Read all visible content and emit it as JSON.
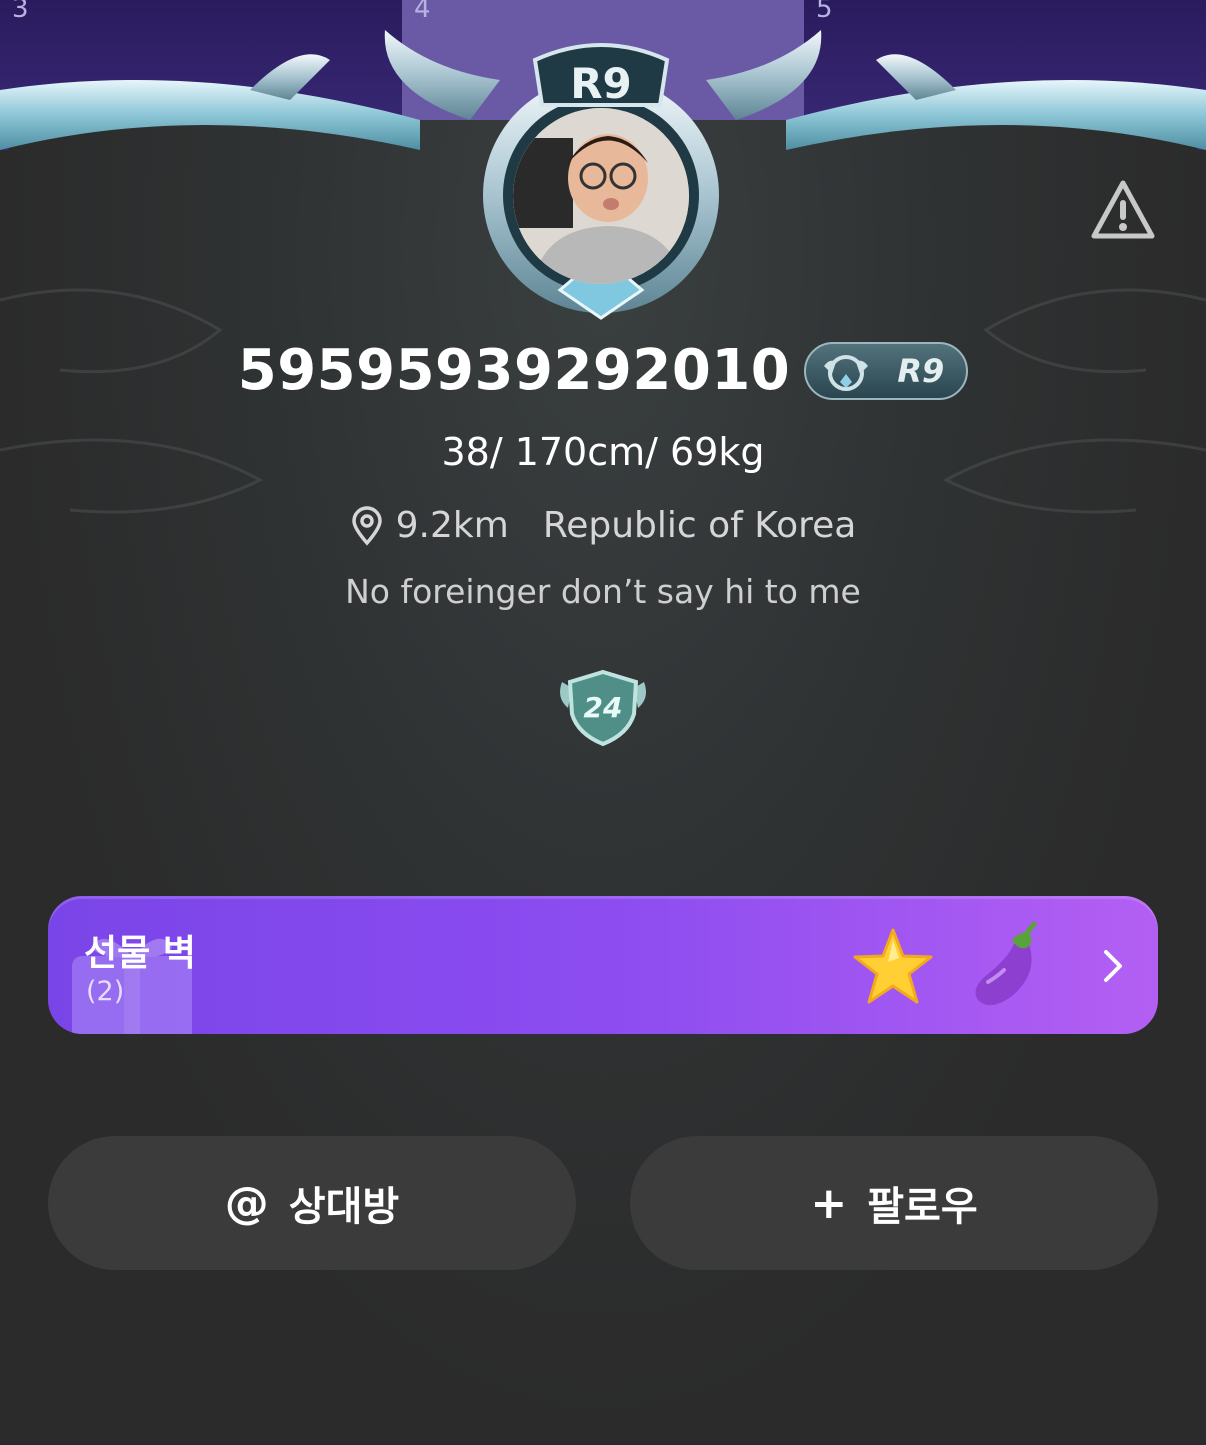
{
  "tabs": {
    "left": "3",
    "center": "4",
    "right": "5"
  },
  "frame": {
    "rank_label": "R9"
  },
  "profile": {
    "username": "59595939292010",
    "rank_badge": "R9",
    "stats": "38/ 170cm/ 69kg",
    "distance": "9.2km",
    "country": "Republic of Korea",
    "bio": "No foreinger don’t say hi to me",
    "level": "24"
  },
  "gift_wall": {
    "title": "선물 벽",
    "count": "(2)"
  },
  "actions": {
    "mention_glyph": "@",
    "mention_label": "상대방",
    "follow_glyph": "+",
    "follow_label": "팔로우"
  },
  "colors": {
    "background": "#2b2b2b",
    "top_strip": "#2a1b5e",
    "gift_wall_start": "#7a45e8",
    "gift_wall_end": "#b35ff3",
    "button": "#3b3b3b"
  },
  "icons": [
    "warning-icon",
    "location-pin-icon",
    "level-shield-icon",
    "star-icon",
    "eggplant-icon",
    "chevron-right-icon"
  ]
}
